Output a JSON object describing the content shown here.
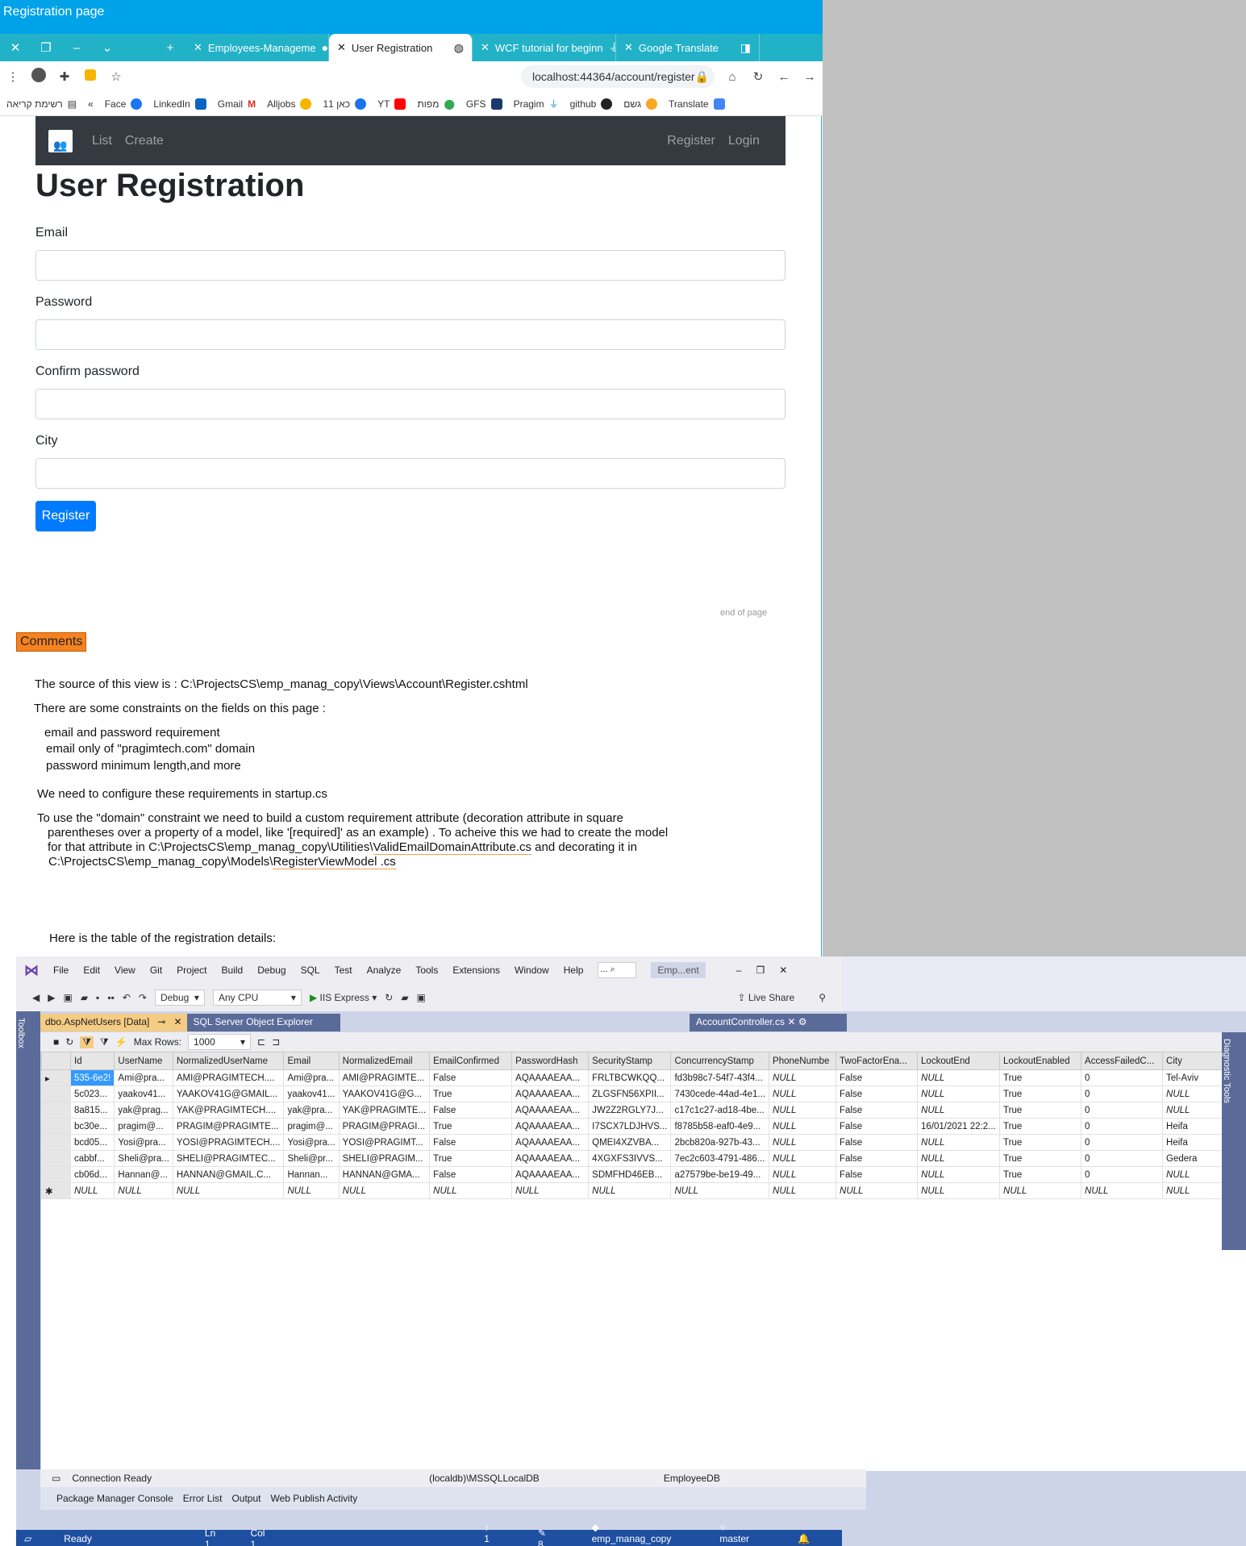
{
  "window": {
    "title": "Registration page"
  },
  "tabs": [
    {
      "label": "Employees-Manageme"
    },
    {
      "label": "User Registration"
    },
    {
      "label": "WCF tutorial for beginn"
    },
    {
      "label": "Google Translate"
    }
  ],
  "address": {
    "url": "localhost:44364/account/register"
  },
  "bookmarks": [
    "רשימת קריאה",
    "Face",
    "LinkedIn",
    "Gmail",
    "Alljobs",
    "כאן 11",
    "YT",
    "מפות",
    "GFS",
    "Pragim",
    "github",
    "גשם",
    "Translate"
  ],
  "nav": {
    "left": [
      "List",
      "Create"
    ],
    "right": [
      "Register",
      "Login"
    ]
  },
  "form": {
    "heading": "User Registration",
    "fields": [
      {
        "label": "Email"
      },
      {
        "label": "Password"
      },
      {
        "label": "Confirm password"
      },
      {
        "label": "City"
      }
    ],
    "submit": "Register",
    "end_note": "end of page"
  },
  "comments": {
    "badge": "Comments",
    "line1": "The source of this view is :  C:\\ProjectsCS\\emp_manag_copy\\Views\\Account\\Register.cshtml",
    "line2": "There are some constraints  on the fields on this page :",
    "c1": "email and password requirement",
    "c2": "email only of \"pragimtech.com\" domain",
    "c3": "password minimum length,and more",
    "line3": "We need to configure these requirements in startup.cs",
    "p1": "To use the \"domain\" constraint we need to build a custom requirement attribute  (decoration attribute  in square",
    "p2": "parentheses over a property of a model, like '[required]' as an example) .   To acheive this we had to create the model",
    "p3a": "for that attribute in C:\\ProjectsCS\\emp_manag_copy\\Utilities\\",
    "p3b": "ValidEmailDomainAttribute.cs",
    "p3c": "  and decorating it in",
    "p4a": "C:\\ProjectsCS\\emp_manag_copy\\Models\\",
    "p4b": "RegisterViewModel .cs",
    "line4": "Here is the table of the registration details:"
  },
  "vs": {
    "menu": [
      "File",
      "Edit",
      "View",
      "Git",
      "Project",
      "Build",
      "Debug",
      "SQL",
      "Test",
      "Analyze",
      "Tools",
      "Extensions",
      "Window",
      "Help"
    ],
    "search": "...",
    "project": "Emp...ent",
    "config": "Debug",
    "platform": "Any CPU",
    "run": "IIS Express",
    "liveshare": "Live Share",
    "toolbox": "Toolbox",
    "doctab1": "dbo.AspNetUsers [Data]",
    "doctab2": "SQL Server Object Explorer",
    "doctab3": "AccountController.cs",
    "maxrows_label": "Max Rows:",
    "maxrows": "1000",
    "columns": [
      "Id",
      "UserName",
      "NormalizedUserName",
      "Email",
      "NormalizedEmail",
      "EmailConfirmed",
      "PasswordHash",
      "SecurityStamp",
      "ConcurrencyStamp",
      "PhoneNumbe",
      "TwoFactorEna...",
      "LockoutEnd",
      "LockoutEnabled",
      "AccessFailedC...",
      "City"
    ],
    "rows": [
      [
        "535-6e2!",
        "Ami@pra...",
        "AMI@PRAGIMTECH....",
        "Ami@pra...",
        "AMI@PRAGIMTE...",
        "False",
        "AQAAAAEAA...",
        "FRLTBCWKQQ...",
        "fd3b98c7-54f7-43f4...",
        "NULL",
        "False",
        "NULL",
        "True",
        "0",
        "Tel-Aviv"
      ],
      [
        "5c023...",
        "yaakov41...",
        "YAAKOV41G@GMAIL...",
        "yaakov41...",
        "YAAKOV41G@G...",
        "True",
        "AQAAAAEAA...",
        "ZLGSFN56XPII...",
        "7430cede-44ad-4e1...",
        "NULL",
        "False",
        "NULL",
        "True",
        "0",
        "NULL"
      ],
      [
        "8a815...",
        "yak@prag...",
        "YAK@PRAGIMTECH....",
        "yak@pra...",
        "YAK@PRAGIMTE...",
        "False",
        "AQAAAAEAA...",
        "JW2Z2RGLY7J...",
        "c17c1c27-ad18-4be...",
        "NULL",
        "False",
        "NULL",
        "True",
        "0",
        "NULL"
      ],
      [
        "bc30e...",
        "pragim@...",
        "PRAGIM@PRAGIMTE...",
        "pragim@...",
        "PRAGIM@PRAGI...",
        "True",
        "AQAAAAEAA...",
        "I7SCX7LDJHVS...",
        "f8785b58-eaf0-4e9...",
        "NULL",
        "False",
        "16/01/2021 22:2...",
        "True",
        "0",
        "Heifa"
      ],
      [
        "bcd05...",
        "Yosi@pra...",
        "YOSI@PRAGIMTECH....",
        "Yosi@pra...",
        "YOSI@PRAGIMT...",
        "False",
        "AQAAAAEAA...",
        "QMEI4XZVBA...",
        "2bcb820a-927b-43...",
        "NULL",
        "False",
        "NULL",
        "True",
        "0",
        "Heifa"
      ],
      [
        "cabbf...",
        "Sheli@pra...",
        "SHELI@PRAGIMTEC...",
        "Sheli@pr...",
        "SHELI@PRAGIM...",
        "True",
        "AQAAAAEAA...",
        "4XGXFS3IVVS...",
        "7ec2c603-4791-486...",
        "NULL",
        "False",
        "NULL",
        "True",
        "0",
        "Gedera"
      ],
      [
        "cb06d...",
        "Hannan@...",
        "HANNAN@GMAIL.C...",
        "Hannan...",
        "HANNAN@GMA...",
        "False",
        "AQAAAAEAA...",
        "SDMFHD46EB...",
        "a27579be-be19-49...",
        "NULL",
        "False",
        "NULL",
        "True",
        "0",
        "NULL"
      ],
      [
        "NULL",
        "NULL",
        "NULL",
        "NULL",
        "NULL",
        "NULL",
        "NULL",
        "NULL",
        "NULL",
        "NULL",
        "NULL",
        "NULL",
        "NULL",
        "NULL",
        "NULL"
      ]
    ],
    "right_tools": "Diagnostic Tools",
    "conn": "Connection Ready",
    "server": "(localdb)\\MSSQLLocalDB",
    "db": "EmployeeDB",
    "tooltabs": [
      "Package Manager Console",
      "Error List",
      "Output",
      "Web Publish Activity"
    ],
    "status": {
      "ready": "Ready",
      "ln": "Ln 1",
      "col": "Col 1",
      "up": "1",
      "edits": "8",
      "repo": "emp_manag_copy",
      "branch": "master"
    }
  }
}
